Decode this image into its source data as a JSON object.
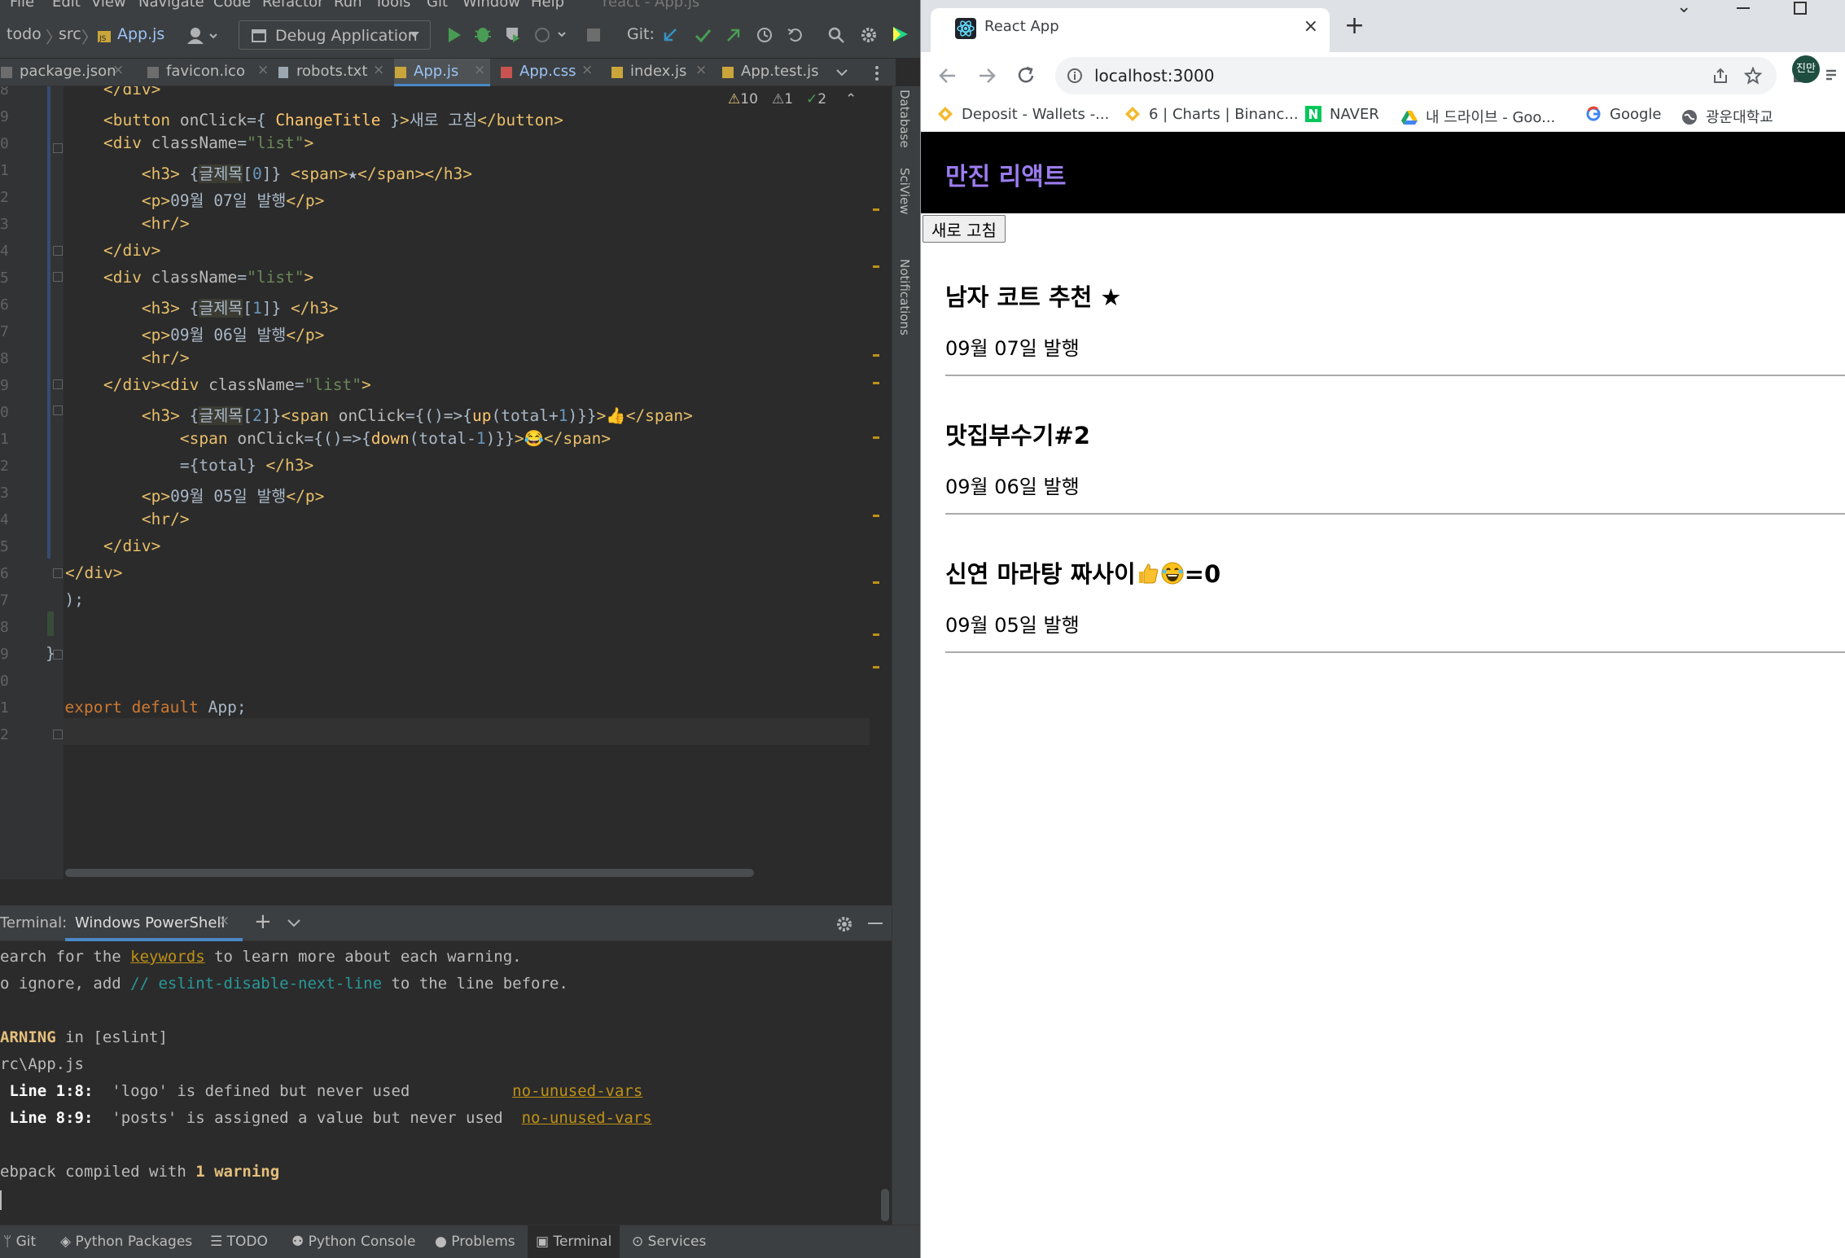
{
  "ide": {
    "menu": [
      "File",
      "Edit",
      "View",
      "Navigate",
      "Code",
      "Refactor",
      "Run",
      "Tools",
      "Git",
      "Window",
      "Help"
    ],
    "window_title": "react - App.js",
    "breadcrumb": [
      "todo",
      "src",
      "App.js"
    ],
    "run_config": "Debug Application",
    "git_label": "Git:",
    "tabs": [
      {
        "label": "package.json",
        "active": false
      },
      {
        "label": "favicon.ico",
        "active": false
      },
      {
        "label": "robots.txt",
        "active": false
      },
      {
        "label": "App.js",
        "active": true
      },
      {
        "label": "App.css",
        "active": false
      },
      {
        "label": "index.js",
        "active": false
      },
      {
        "label": "App.test.js",
        "active": false
      }
    ],
    "inspections": {
      "warnings": "10",
      "weak": "1",
      "ok": "2"
    },
    "line_numbers": [
      "8",
      "9",
      "0",
      "1",
      "2",
      "3",
      "4",
      "5",
      "6",
      "7",
      "8",
      "9",
      "0",
      "1",
      "2",
      "3",
      "4",
      "5",
      "6",
      "7",
      "8",
      "9",
      "0",
      "1",
      "2"
    ],
    "side_tools": [
      "Database",
      "SciView",
      "Notifications"
    ],
    "terminal": {
      "label": "Terminal:",
      "tab": "Windows PowerShell",
      "lines": {
        "l1a": "earch for the ",
        "l1b": "keywords",
        "l1c": " to learn more about each warning.",
        "l2a": "o ignore, add ",
        "l2b": "// eslint-disable-next-line",
        "l2c": " to the line before.",
        "l3a": "ARNING",
        "l3b": " in [eslint]",
        "l4": "rc\\App.js",
        "l5a": " Line 1:8:",
        "l5b": "  'logo' is defined but never used           ",
        "l5c": "no-unused-vars",
        "l6a": " Line 8:9:",
        "l6b": "  'posts' is assigned a value but never used  ",
        "l6c": "no-unused-vars",
        "l7a": "ebpack compiled with ",
        "l7b": "1 warning"
      }
    },
    "status_tabs": [
      "Git",
      "Python Packages",
      "TODO",
      "Python Console",
      "Problems",
      "Terminal",
      "Services"
    ]
  },
  "browser": {
    "tab_title": "React App",
    "url": "localhost:3000",
    "profile": "진만",
    "bookmarks": [
      "Deposit - Wallets -...",
      "6 | Charts | Binanc...",
      "NAVER",
      "내 드라이브 - Goo...",
      "Google",
      "광운대학교"
    ]
  },
  "app": {
    "brand": "만진 리액트",
    "button": "새로 고침",
    "posts": [
      {
        "title": "남자 코트 추천",
        "suffix": " ★",
        "date": "09월 07일 발행"
      },
      {
        "title": "맛집부수기#2",
        "suffix": "",
        "date": "09월 06일 발행"
      },
      {
        "title": "신연 마라탕 짜사이",
        "suffix": "=0",
        "date": "09월 05일 발행"
      }
    ]
  },
  "colors": {
    "accent": "#9c7cf0",
    "ide_bg": "#2b2b2b",
    "warning": "#be9117"
  }
}
